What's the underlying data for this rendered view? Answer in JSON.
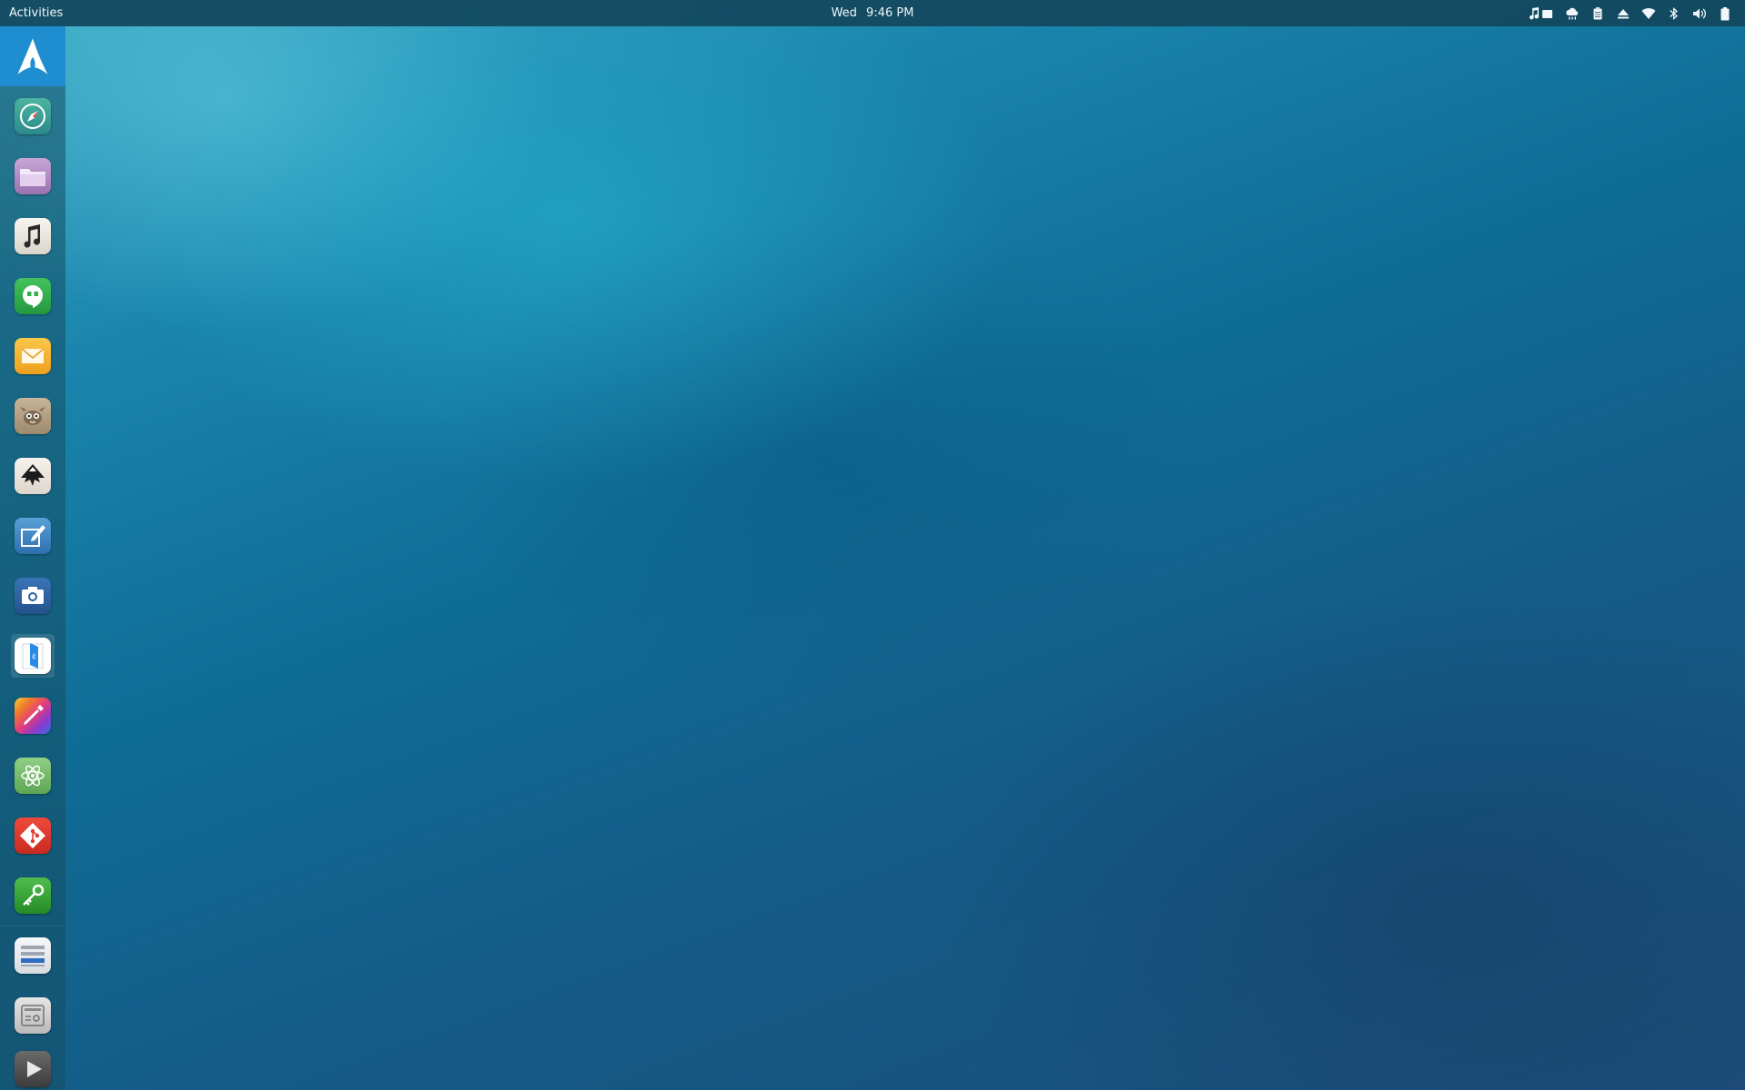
{
  "topbar": {
    "activities_label": "Activities",
    "clock_day": "Wed",
    "clock_time": "9:46 PM",
    "tray_icons": [
      "music-player-icon",
      "weather-cloud-icon",
      "clipboard-icon",
      "eject-icon",
      "wifi-icon",
      "bluetooth-icon",
      "volume-icon",
      "battery-icon"
    ]
  },
  "dock": {
    "items": [
      {
        "name": "arch-logo-icon",
        "color": "#1f8ed0"
      },
      {
        "name": "web-browser-icon",
        "color": "#3a9d8f"
      },
      {
        "name": "files-folder-icon",
        "color": "#b48fc4"
      },
      {
        "name": "music-icon",
        "color": "#e9e6df"
      },
      {
        "name": "hangouts-icon",
        "color": "#2fb24c"
      },
      {
        "name": "mail-icon",
        "color": "#f5b52e"
      },
      {
        "name": "gimp-icon",
        "color": "#b7a48b"
      },
      {
        "name": "inkscape-icon",
        "color": "#ece8e2"
      },
      {
        "name": "drawing-icon",
        "color": "#3f86c6"
      },
      {
        "name": "screenshot-camera-icon",
        "color": "#2c5f9e"
      },
      {
        "name": "text-editor-icon",
        "color": "#f2f2f2"
      },
      {
        "name": "color-picker-icon",
        "color": "#d64a9c"
      },
      {
        "name": "atom-editor-icon",
        "color": "#7cc06e"
      },
      {
        "name": "git-icon",
        "color": "#e23a2f"
      },
      {
        "name": "passwords-keys-icon",
        "color": "#3aa83a"
      },
      {
        "name": "system-monitor-icon",
        "color": "#eceff3"
      },
      {
        "name": "hardware-settings-icon",
        "color": "#d8d8d8"
      },
      {
        "name": "media-player-icon",
        "color": "#555555"
      }
    ]
  }
}
